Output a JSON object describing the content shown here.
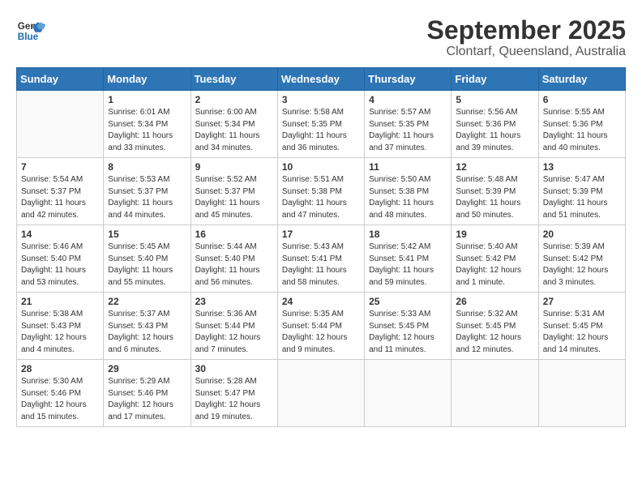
{
  "logo": {
    "line1": "General",
    "line2": "Blue"
  },
  "title": "September 2025",
  "subtitle": "Clontarf, Queensland, Australia",
  "weekdays": [
    "Sunday",
    "Monday",
    "Tuesday",
    "Wednesday",
    "Thursday",
    "Friday",
    "Saturday"
  ],
  "weeks": [
    [
      {
        "day": "",
        "info": ""
      },
      {
        "day": "1",
        "info": "Sunrise: 6:01 AM\nSunset: 5:34 PM\nDaylight: 11 hours\nand 33 minutes."
      },
      {
        "day": "2",
        "info": "Sunrise: 6:00 AM\nSunset: 5:34 PM\nDaylight: 11 hours\nand 34 minutes."
      },
      {
        "day": "3",
        "info": "Sunrise: 5:58 AM\nSunset: 5:35 PM\nDaylight: 11 hours\nand 36 minutes."
      },
      {
        "day": "4",
        "info": "Sunrise: 5:57 AM\nSunset: 5:35 PM\nDaylight: 11 hours\nand 37 minutes."
      },
      {
        "day": "5",
        "info": "Sunrise: 5:56 AM\nSunset: 5:36 PM\nDaylight: 11 hours\nand 39 minutes."
      },
      {
        "day": "6",
        "info": "Sunrise: 5:55 AM\nSunset: 5:36 PM\nDaylight: 11 hours\nand 40 minutes."
      }
    ],
    [
      {
        "day": "7",
        "info": "Sunrise: 5:54 AM\nSunset: 5:37 PM\nDaylight: 11 hours\nand 42 minutes."
      },
      {
        "day": "8",
        "info": "Sunrise: 5:53 AM\nSunset: 5:37 PM\nDaylight: 11 hours\nand 44 minutes."
      },
      {
        "day": "9",
        "info": "Sunrise: 5:52 AM\nSunset: 5:37 PM\nDaylight: 11 hours\nand 45 minutes."
      },
      {
        "day": "10",
        "info": "Sunrise: 5:51 AM\nSunset: 5:38 PM\nDaylight: 11 hours\nand 47 minutes."
      },
      {
        "day": "11",
        "info": "Sunrise: 5:50 AM\nSunset: 5:38 PM\nDaylight: 11 hours\nand 48 minutes."
      },
      {
        "day": "12",
        "info": "Sunrise: 5:48 AM\nSunset: 5:39 PM\nDaylight: 11 hours\nand 50 minutes."
      },
      {
        "day": "13",
        "info": "Sunrise: 5:47 AM\nSunset: 5:39 PM\nDaylight: 11 hours\nand 51 minutes."
      }
    ],
    [
      {
        "day": "14",
        "info": "Sunrise: 5:46 AM\nSunset: 5:40 PM\nDaylight: 11 hours\nand 53 minutes."
      },
      {
        "day": "15",
        "info": "Sunrise: 5:45 AM\nSunset: 5:40 PM\nDaylight: 11 hours\nand 55 minutes."
      },
      {
        "day": "16",
        "info": "Sunrise: 5:44 AM\nSunset: 5:40 PM\nDaylight: 11 hours\nand 56 minutes."
      },
      {
        "day": "17",
        "info": "Sunrise: 5:43 AM\nSunset: 5:41 PM\nDaylight: 11 hours\nand 58 minutes."
      },
      {
        "day": "18",
        "info": "Sunrise: 5:42 AM\nSunset: 5:41 PM\nDaylight: 11 hours\nand 59 minutes."
      },
      {
        "day": "19",
        "info": "Sunrise: 5:40 AM\nSunset: 5:42 PM\nDaylight: 12 hours\nand 1 minute."
      },
      {
        "day": "20",
        "info": "Sunrise: 5:39 AM\nSunset: 5:42 PM\nDaylight: 12 hours\nand 3 minutes."
      }
    ],
    [
      {
        "day": "21",
        "info": "Sunrise: 5:38 AM\nSunset: 5:43 PM\nDaylight: 12 hours\nand 4 minutes."
      },
      {
        "day": "22",
        "info": "Sunrise: 5:37 AM\nSunset: 5:43 PM\nDaylight: 12 hours\nand 6 minutes."
      },
      {
        "day": "23",
        "info": "Sunrise: 5:36 AM\nSunset: 5:44 PM\nDaylight: 12 hours\nand 7 minutes."
      },
      {
        "day": "24",
        "info": "Sunrise: 5:35 AM\nSunset: 5:44 PM\nDaylight: 12 hours\nand 9 minutes."
      },
      {
        "day": "25",
        "info": "Sunrise: 5:33 AM\nSunset: 5:45 PM\nDaylight: 12 hours\nand 11 minutes."
      },
      {
        "day": "26",
        "info": "Sunrise: 5:32 AM\nSunset: 5:45 PM\nDaylight: 12 hours\nand 12 minutes."
      },
      {
        "day": "27",
        "info": "Sunrise: 5:31 AM\nSunset: 5:45 PM\nDaylight: 12 hours\nand 14 minutes."
      }
    ],
    [
      {
        "day": "28",
        "info": "Sunrise: 5:30 AM\nSunset: 5:46 PM\nDaylight: 12 hours\nand 15 minutes."
      },
      {
        "day": "29",
        "info": "Sunrise: 5:29 AM\nSunset: 5:46 PM\nDaylight: 12 hours\nand 17 minutes."
      },
      {
        "day": "30",
        "info": "Sunrise: 5:28 AM\nSunset: 5:47 PM\nDaylight: 12 hours\nand 19 minutes."
      },
      {
        "day": "",
        "info": ""
      },
      {
        "day": "",
        "info": ""
      },
      {
        "day": "",
        "info": ""
      },
      {
        "day": "",
        "info": ""
      }
    ]
  ]
}
